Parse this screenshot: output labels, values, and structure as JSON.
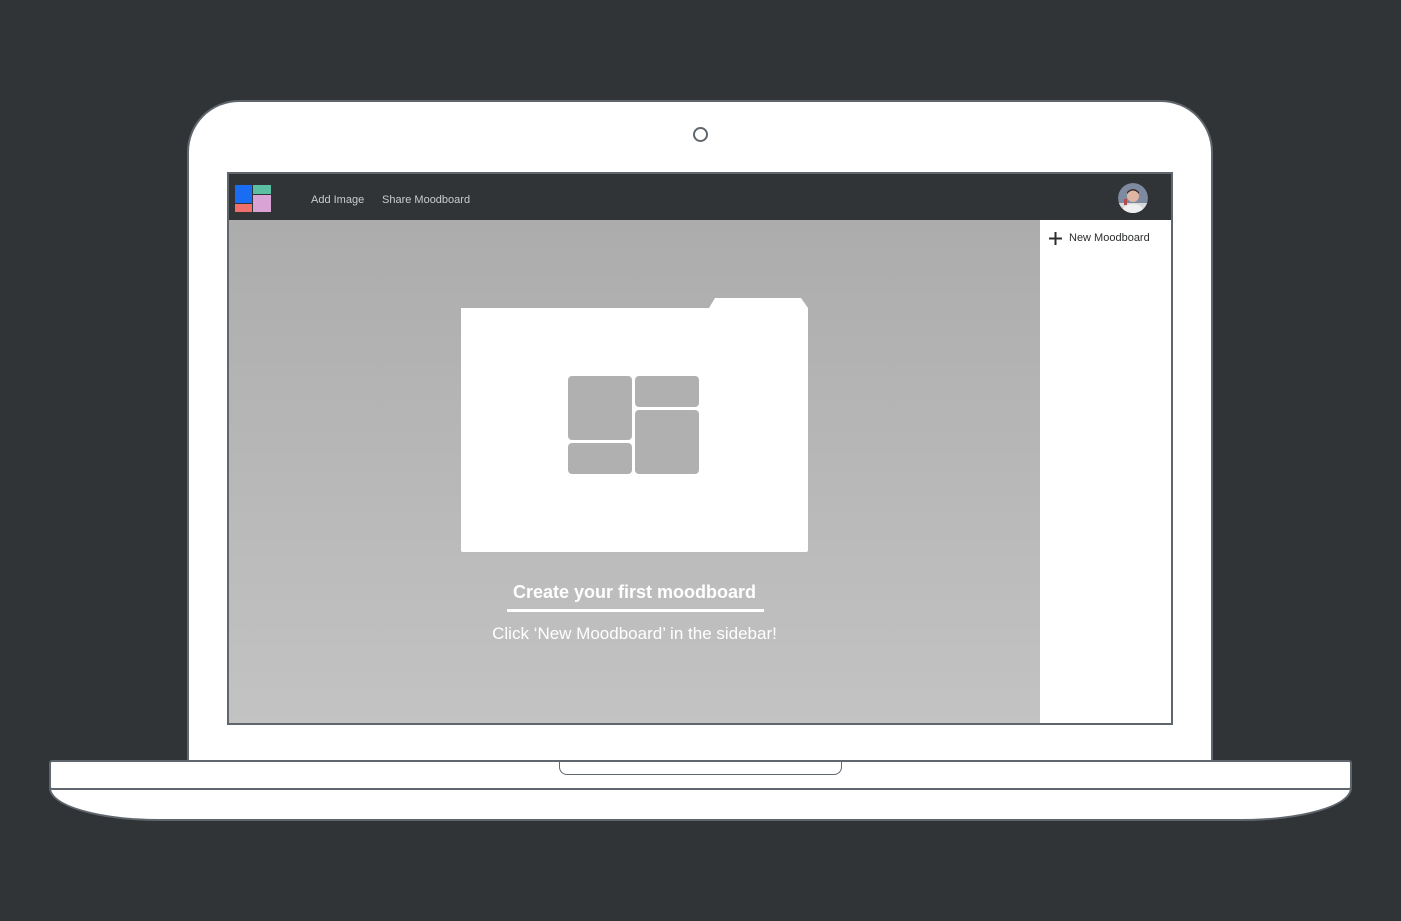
{
  "nav": {
    "add_image": "Add Image",
    "share_moodboard": "Share Moodboard"
  },
  "sidebar": {
    "new_moodboard": "New Moodboard"
  },
  "empty_state": {
    "title": "Create your first moodboard",
    "subtitle": "Click ‘New Moodboard’ in the sidebar!"
  },
  "colors": {
    "frame": "#313436",
    "screen_bg": "#acacac",
    "logo_blue": "#1a6cf2",
    "logo_teal": "#5bbfa3",
    "logo_red": "#f06f6a",
    "logo_pink": "#d9a3d6"
  },
  "icons": {
    "logo": "moodboard-logo",
    "avatar": "user-avatar",
    "plus": "plus-icon",
    "folder": "folder-grid-icon"
  }
}
